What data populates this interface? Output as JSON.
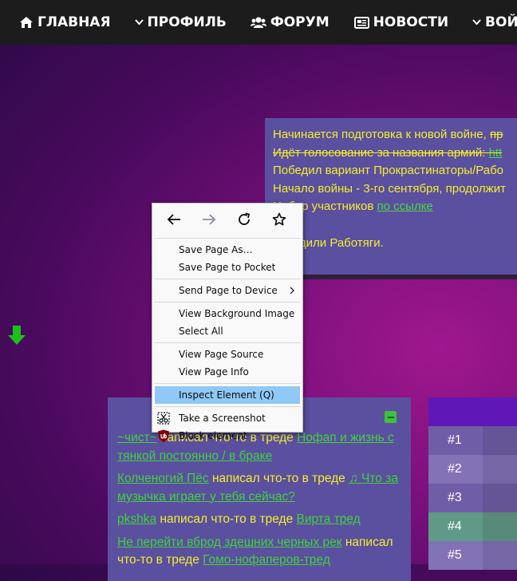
{
  "nav": {
    "items": [
      {
        "icon": "home-icon",
        "label": "ГЛАВНАЯ"
      },
      {
        "icon": "chevron-down-icon",
        "label": "ПРОФИЛЬ"
      },
      {
        "icon": "users-icon",
        "label": "ФОРУМ"
      },
      {
        "icon": "newspaper-icon",
        "label": "НОВОСТИ"
      },
      {
        "icon": "chevron-down-icon",
        "label": "ВОЙНА"
      }
    ]
  },
  "news": {
    "line1_text": "Начинается подготовка к новой войне, ",
    "line1_struck": "пр",
    "line2_struck": "Идёт голосование за названия армий: ",
    "line2_link": "htt",
    "line3": "Победил вариант Прокрастинаторы/Рабо",
    "line4": "Начало войны - 3-го сентября, продолжит",
    "line5_text": "Набор участников ",
    "line5_link": "по ссылке",
    "line6": "победили Работяги."
  },
  "context_menu": {
    "back": "back-arrow-icon",
    "forward": "forward-arrow-icon",
    "reload": "reload-icon",
    "bookmark": "star-icon",
    "items": {
      "save_page_as": "Save Page As…",
      "save_to_pocket": "Save Page to Pocket",
      "send_to_device": "Send Page to Device",
      "view_bg_image": "View Background Image",
      "select_all": "Select All",
      "view_source": "View Page Source",
      "view_info": "View Page Info",
      "inspect": "Inspect Element (Q)",
      "screenshot": "Take a Screenshot",
      "block": "Block element"
    }
  },
  "activity": {
    "items": [
      {
        "user": "~чист~",
        "action": " написал что-то в треде ",
        "thread": "Нофап и жизнь с тянкой постоянно / в браке"
      },
      {
        "user": "Колченогий Пёс",
        "action": " написал что-то в треде ",
        "thread": "♫ Что за музычка играет у тебя сейчас?"
      },
      {
        "user": "pkshka",
        "action": " написал что-то в треде ",
        "thread": "Вирта тред"
      },
      {
        "user": "Не перейти вброд здешних черных рек",
        "action": " написал что-то в треде ",
        "thread": "Гомо-нофаперов-тред"
      }
    ]
  },
  "ranking": {
    "rows": [
      "#1",
      "#2",
      "#3",
      "#4",
      "#5"
    ]
  },
  "colors": {
    "nav_bg": "#1c1c1c",
    "panel_bg": "#5b4fa0",
    "text_yellow": "#f2ef2a",
    "link_green": "#4bd840",
    "menu_highlight": "#90c8f6"
  }
}
